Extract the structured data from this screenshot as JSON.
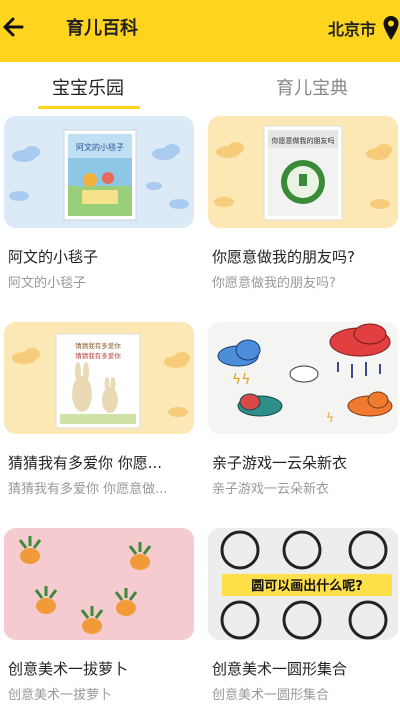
{
  "header": {
    "title": "育儿百科",
    "city": "北京市"
  },
  "tabs": [
    {
      "label": "宝宝乐园"
    },
    {
      "label": "育儿宝典"
    }
  ],
  "cards": [
    {
      "title": "阿文的小毯子",
      "subtitle": "阿文的小毯子",
      "thumb": "blue-sky-book",
      "book_text": "阿文的小毯子"
    },
    {
      "title": "你愿意做我的朋友吗?",
      "subtitle": "你愿意做我的朋友吗?",
      "thumb": "yellow-sky-book",
      "book_text": "你愿意做我的朋友吗"
    },
    {
      "title": "猜猜我有多爱你 你愿...",
      "subtitle": "猜猜我有多爱你 你愿意做...",
      "thumb": "yellow-sky-rabbit-book",
      "book_text": "猜猜我有多爱你"
    },
    {
      "title": "亲子游戏一云朵新衣",
      "subtitle": "亲子游戏一云朵新衣",
      "thumb": "cloud-drawings"
    },
    {
      "title": "创意美术一拔萝卜",
      "subtitle": "创意美术一拔萝卜",
      "thumb": "pink-carrots"
    },
    {
      "title": "创意美术一圆形集合",
      "subtitle": "创意美术一圆形集合",
      "thumb": "circles-board",
      "banner": "圆可以画出什么呢?"
    }
  ]
}
